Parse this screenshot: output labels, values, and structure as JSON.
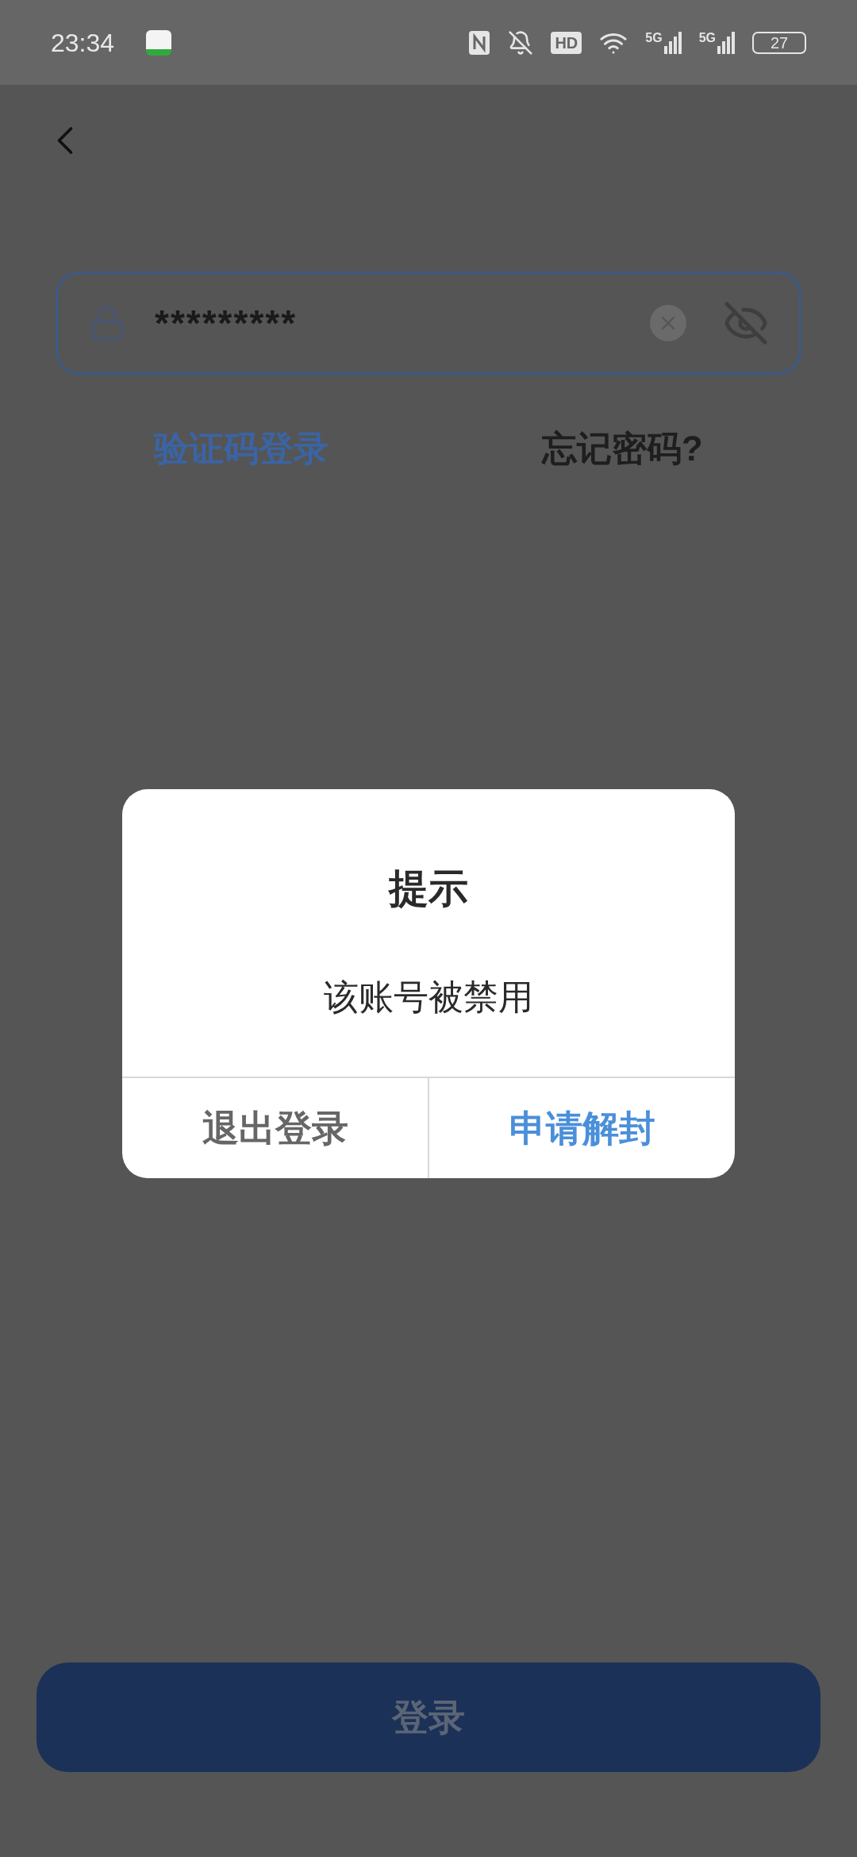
{
  "status_bar": {
    "time": "23:34",
    "hd_label": "HD",
    "signal_labels": [
      "5G",
      "5G"
    ],
    "battery": "27"
  },
  "password_field": {
    "value": "*********"
  },
  "links": [
    {
      "label": "验证码登录",
      "kind": "accent"
    },
    {
      "label": "忘记密码?",
      "kind": "plain"
    }
  ],
  "dialog": {
    "title": "提示",
    "message": "该账号被禁用",
    "buttons": [
      {
        "label": "退出登录",
        "kind": "secondary"
      },
      {
        "label": "申请解封",
        "kind": "primary"
      }
    ]
  },
  "login_button": {
    "label": "登录"
  }
}
